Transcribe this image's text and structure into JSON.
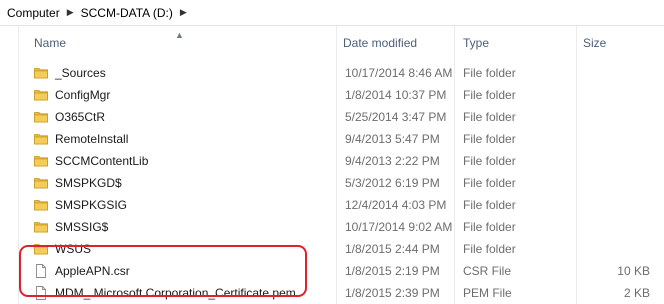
{
  "breadcrumb": {
    "items": [
      "Computer",
      "SCCM-DATA (D:)"
    ]
  },
  "columns": {
    "name": "Name",
    "date": "Date modified",
    "type": "Type",
    "size": "Size"
  },
  "files": [
    {
      "name": "_Sources",
      "date": "10/17/2014 8:46 AM",
      "type": "File folder",
      "size": "",
      "icon": "folder-icon"
    },
    {
      "name": "ConfigMgr",
      "date": "1/8/2014 10:37 PM",
      "type": "File folder",
      "size": "",
      "icon": "folder-icon"
    },
    {
      "name": "O365CtR",
      "date": "5/25/2014 3:47 PM",
      "type": "File folder",
      "size": "",
      "icon": "folder-icon"
    },
    {
      "name": "RemoteInstall",
      "date": "9/4/2013 5:47 PM",
      "type": "File folder",
      "size": "",
      "icon": "folder-icon"
    },
    {
      "name": "SCCMContentLib",
      "date": "9/4/2013 2:22 PM",
      "type": "File folder",
      "size": "",
      "icon": "folder-icon"
    },
    {
      "name": "SMSPKGD$",
      "date": "5/3/2012 6:19 PM",
      "type": "File folder",
      "size": "",
      "icon": "folder-icon"
    },
    {
      "name": "SMSPKGSIG",
      "date": "12/4/2014 4:03 PM",
      "type": "File folder",
      "size": "",
      "icon": "folder-icon"
    },
    {
      "name": "SMSSIG$",
      "date": "10/17/2014 9:02 AM",
      "type": "File folder",
      "size": "",
      "icon": "folder-icon"
    },
    {
      "name": "WSUS",
      "date": "1/8/2015 2:44 PM",
      "type": "File folder",
      "size": "",
      "icon": "folder-icon"
    },
    {
      "name": "AppleAPN.csr",
      "date": "1/8/2015 2:19 PM",
      "type": "CSR File",
      "size": "10 KB",
      "icon": "file-icon"
    },
    {
      "name": "MDM_ Microsoft Corporation_Certificate.pem",
      "date": "1/8/2015 2:39 PM",
      "type": "PEM File",
      "size": "2 KB",
      "icon": "file-icon"
    }
  ],
  "colors": {
    "folder": "#e9b93d",
    "header_text": "#4c607a",
    "highlight_border": "#e2202b"
  }
}
